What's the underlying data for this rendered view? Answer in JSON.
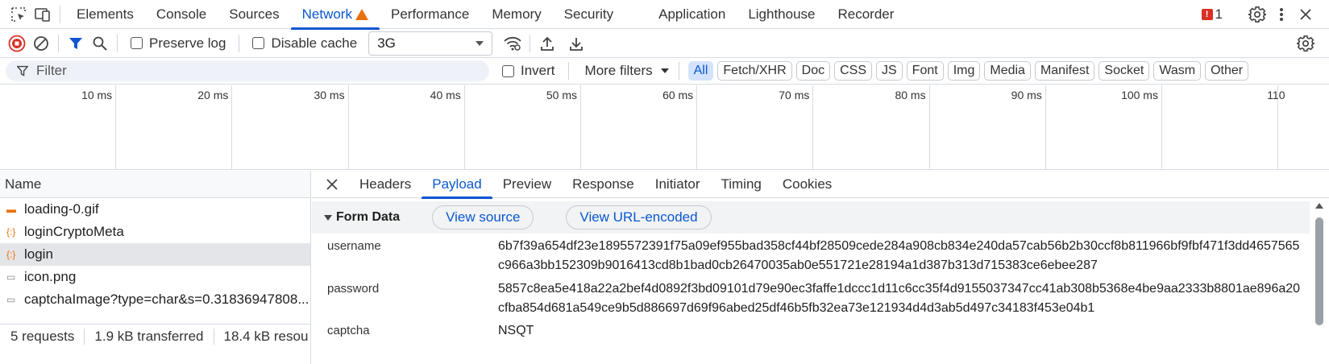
{
  "tabs": [
    "Elements",
    "Console",
    "Sources",
    "Network",
    "Performance",
    "Memory",
    "Security",
    "Application",
    "Lighthouse",
    "Recorder"
  ],
  "active_tab": "Network",
  "issues_count": "1",
  "toolbar": {
    "preserve_log": "Preserve log",
    "disable_cache": "Disable cache",
    "throttle": "3G"
  },
  "filter": {
    "placeholder": "Filter",
    "invert": "Invert",
    "more_filters": "More filters",
    "types": [
      "All",
      "Fetch/XHR",
      "Doc",
      "CSS",
      "JS",
      "Font",
      "Img",
      "Media",
      "Manifest",
      "Socket",
      "Wasm",
      "Other"
    ]
  },
  "timeline_ticks": [
    "10 ms",
    "20 ms",
    "30 ms",
    "40 ms",
    "50 ms",
    "60 ms",
    "70 ms",
    "80 ms",
    "90 ms",
    "100 ms",
    "110"
  ],
  "requests": {
    "header": "Name",
    "items": [
      {
        "name": "loading-0.gif",
        "icon": "{…}"
      },
      {
        "name": "loginCryptoMeta",
        "icon": "{:}"
      },
      {
        "name": "login",
        "icon": "{:}"
      },
      {
        "name": "icon.png",
        "icon": "img"
      },
      {
        "name": "captchaImage?type=char&s=0.31836947808...",
        "icon": "img"
      }
    ]
  },
  "status_bar": {
    "requests": "5 requests",
    "transferred": "1.9 kB transferred",
    "resources": "18.4 kB resou"
  },
  "detail_tabs": [
    "Headers",
    "Payload",
    "Preview",
    "Response",
    "Initiator",
    "Timing",
    "Cookies"
  ],
  "active_detail_tab": "Payload",
  "payload": {
    "section_title": "Form Data",
    "view_source": "View source",
    "view_url_encoded": "View URL-encoded",
    "fields": [
      {
        "key": "username",
        "value": "6b7f39a654df23e1895572391f75a09ef955bad358cf44bf28509cede284a908cb834e240da57cab56b2b30ccf8b811966bf9fbf471f3dd4657565c966a3bb152309b9016413cd8b1bad0cb26470035ab0e551721e28194a1d387b313d715383ce6ebee287"
      },
      {
        "key": "password",
        "value": "5857c8ea5e418a22a2bef4d0892f3bd09101d79e90ec3faffe1dccc1d11c6cc35f4d9155037347cc41ab308b5368e4be9aa2333b8801ae896a20cfba854d681a549ce9b5d886697d69f96abed25df46b5fb32ea73e121934d4d3ab5d497c34183f453e04b1"
      },
      {
        "key": "captcha",
        "value": "NSQT"
      }
    ]
  },
  "colors": {
    "accent": "#0b57d0",
    "warning": "#e8710a",
    "record": "#d93025"
  }
}
